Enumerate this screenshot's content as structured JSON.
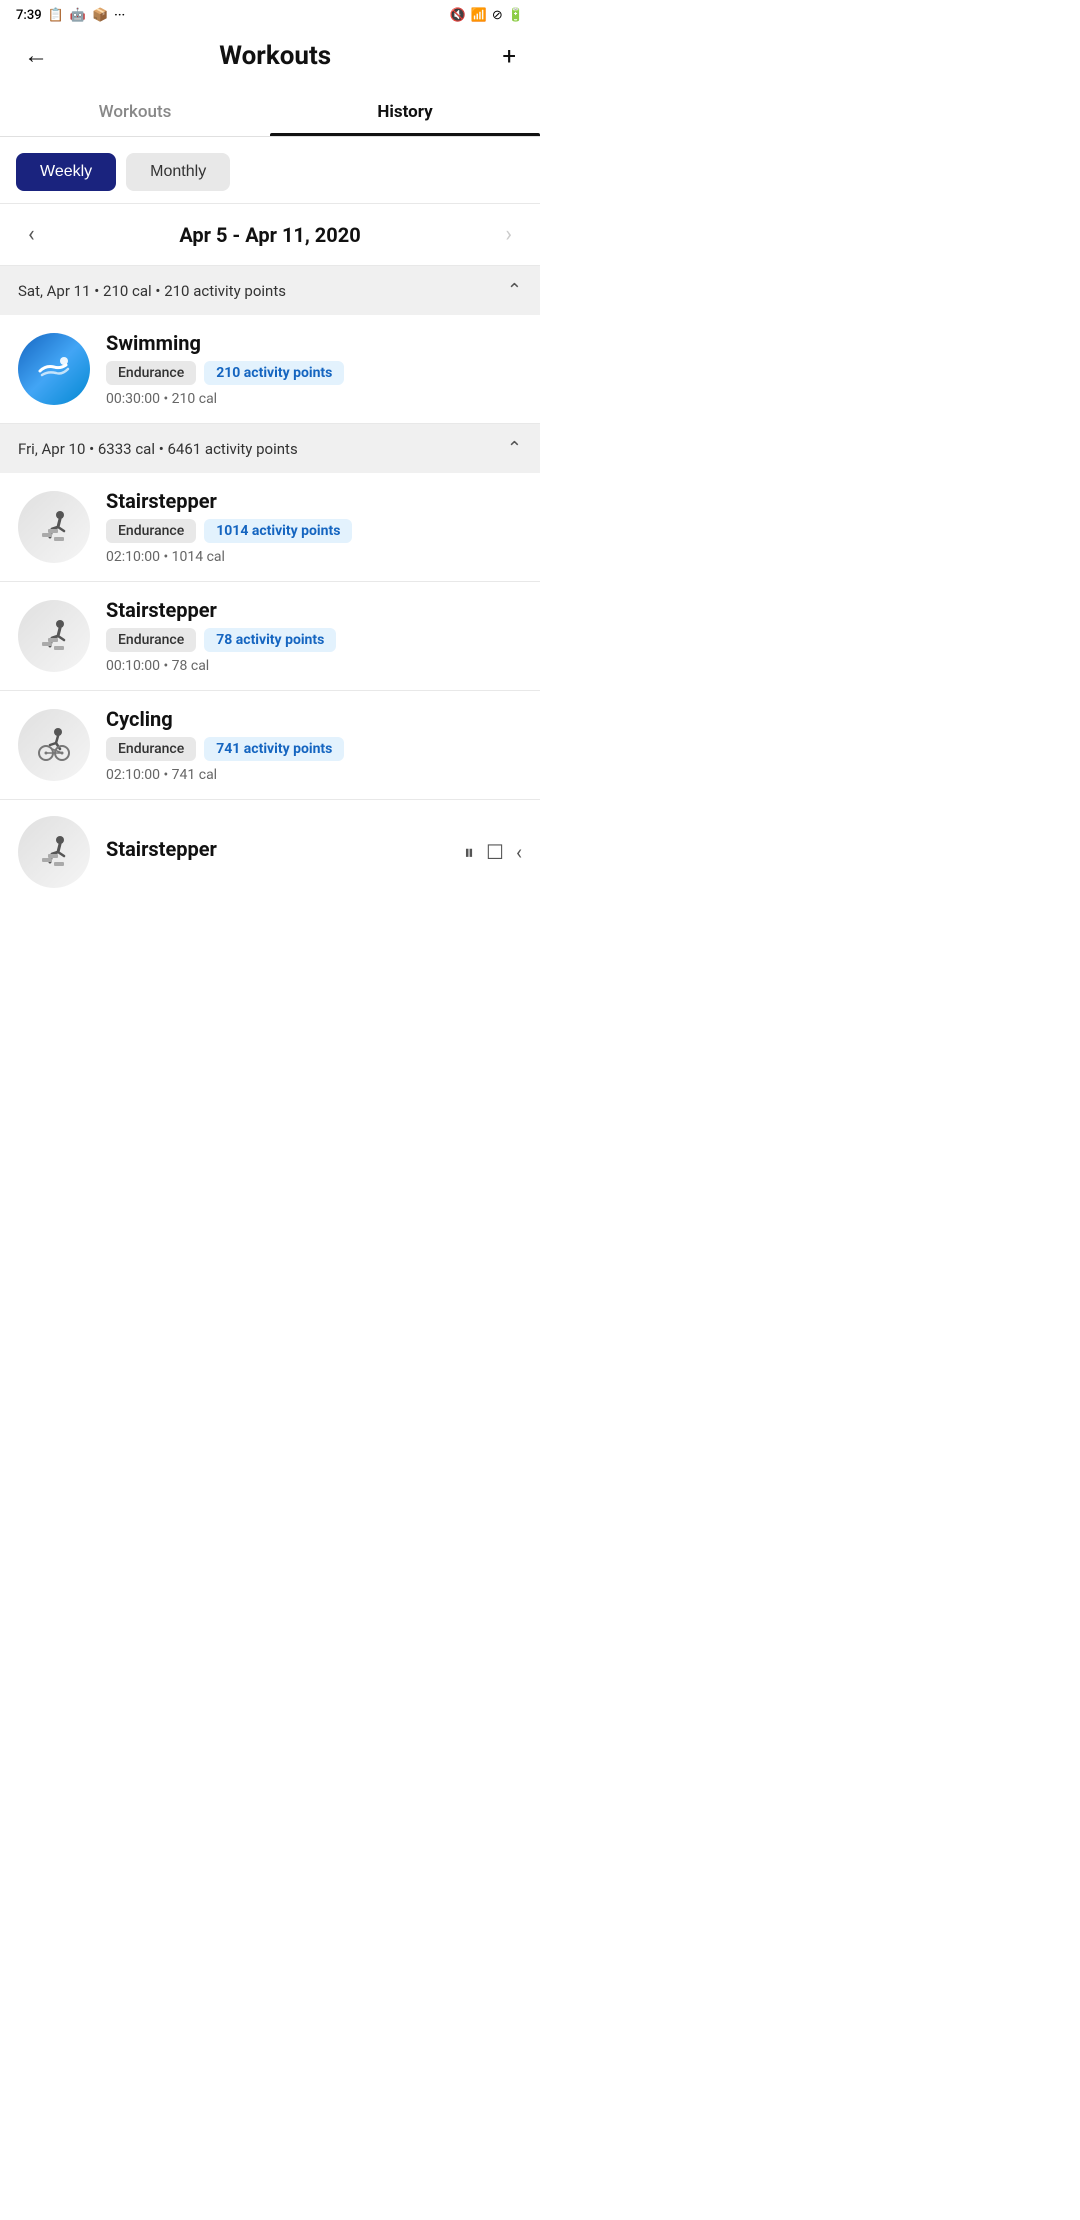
{
  "statusBar": {
    "time": "7:39",
    "icons": [
      "clipboard",
      "android",
      "archive",
      "dots"
    ]
  },
  "appBar": {
    "title": "Workouts",
    "backLabel": "←",
    "addLabel": "+"
  },
  "tabs": [
    {
      "id": "workouts",
      "label": "Workouts",
      "active": false
    },
    {
      "id": "history",
      "label": "History",
      "active": true
    }
  ],
  "viewSelector": {
    "weekly": "Weekly",
    "monthly": "Monthly"
  },
  "dateNav": {
    "label": "Apr 5 - Apr 11, 2020",
    "prevDisabled": false,
    "nextDisabled": true
  },
  "daySections": [
    {
      "id": "sat-apr-11",
      "header": "Sat, Apr 11 • 210 cal • 210 activity points",
      "expanded": true,
      "workouts": [
        {
          "id": "swimming-1",
          "name": "Swimming",
          "type": "swimming",
          "tag1": "Endurance",
          "tag2": "210 activity points",
          "stats": "00:30:00 • 210 cal"
        }
      ]
    },
    {
      "id": "fri-apr-10",
      "header": "Fri, Apr 10 • 6333 cal • 6461 activity points",
      "expanded": true,
      "workouts": [
        {
          "id": "stairstepper-1",
          "name": "Stairstepper",
          "type": "stairstepper",
          "tag1": "Endurance",
          "tag2": "1014 activity points",
          "stats": "02:10:00 • 1014 cal"
        },
        {
          "id": "stairstepper-2",
          "name": "Stairstepper",
          "type": "stairstepper",
          "tag1": "Endurance",
          "tag2": "78 activity points",
          "stats": "00:10:00 • 78 cal"
        },
        {
          "id": "cycling-1",
          "name": "Cycling",
          "type": "cycling",
          "tag1": "Endurance",
          "tag2": "741 activity points",
          "stats": "02:10:00 • 741 cal"
        }
      ]
    }
  ],
  "partialItem": {
    "name": "Stairstepper",
    "pauseIcon": "⏸",
    "checkIcon": "☐",
    "backIcon": "‹"
  }
}
